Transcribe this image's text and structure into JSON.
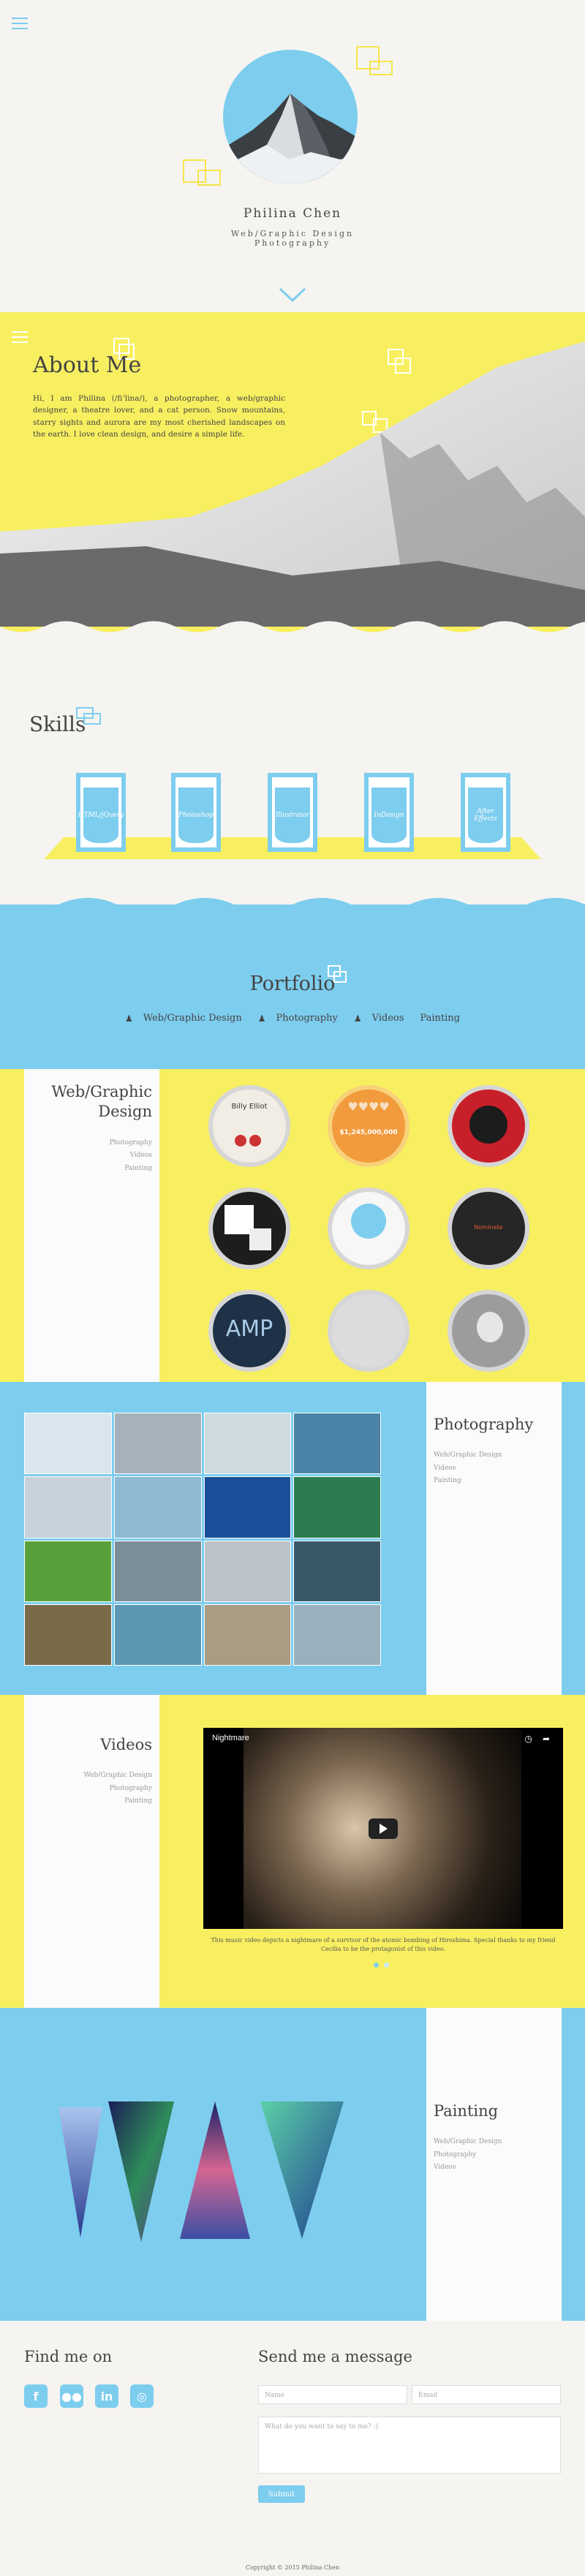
{
  "hero": {
    "name": "Philina Chen",
    "role_line1": "Web/Graphic Design",
    "role_line2": "Photography"
  },
  "about": {
    "title": "About Me",
    "text": "Hi, I am Philina (/fiʼlina/), a photographer, a web/graphic designer, a theatre lover, and a cat person. Snow mountains, starry sights and aurora are my most cherished landscapes on the earth. I love clean design, and desire a simple life."
  },
  "skills": {
    "title": "Skills",
    "items": [
      "HTML/jQuery",
      "Photoshop",
      "Illustrator",
      "InDesign",
      "After Effects"
    ]
  },
  "portfolio": {
    "title": "Portfolio",
    "nav": [
      "Web/Graphic Design",
      "Photography",
      "Videos",
      "Painting"
    ]
  },
  "webdesign": {
    "title_line1": "Web/Graphic",
    "title_line2": "Design",
    "links": [
      "Photography",
      "Videos",
      "Painting"
    ],
    "thumb_text": [
      "Billy Elliot",
      "$1,245,000,000",
      "Nominate"
    ]
  },
  "photography": {
    "title": "Photography",
    "links": [
      "Web/Graphic Design",
      "Videos",
      "Painting"
    ]
  },
  "videos": {
    "title": "Videos",
    "links": [
      "Web/Graphic Design",
      "Photography",
      "Painting"
    ],
    "player_title": "Nightmare",
    "caption": "This music video depicts a nightmare of a survivor of the atomic bombing of Hiroshima. Special thanks to my friend Cecilia to be the protagonist of this video."
  },
  "painting": {
    "title": "Painting",
    "links": [
      "Web/Graphic Design",
      "Photography",
      "Videos"
    ]
  },
  "contact": {
    "find_title": "Find me on",
    "social": [
      "facebook-icon",
      "flickr-icon",
      "linkedin-icon",
      "instagram-icon"
    ],
    "message_title": "Send me a message",
    "name_placeholder": "Name",
    "email_placeholder": "Email",
    "message_placeholder": "What do you want to say to me? :)",
    "submit_label": "Submit",
    "copyright": "Copyright © 2015 Philina Chen"
  },
  "colors": {
    "accent_blue": "#7dcdee",
    "accent_yellow": "#f8ef60"
  }
}
